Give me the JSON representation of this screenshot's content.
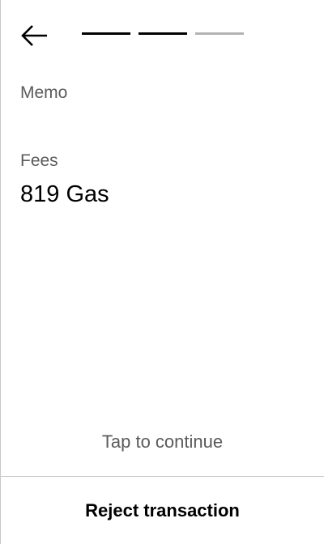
{
  "header": {
    "back_icon": "arrow-left-icon",
    "progress": {
      "total_steps": 3,
      "completed_steps": 2,
      "active_color": "#000000",
      "pending_color": "#b3b3b3"
    }
  },
  "details": {
    "memo_label": "Memo",
    "fees_label": "Fees",
    "fees_value": "819 Gas"
  },
  "footer": {
    "tap_to_continue": "Tap to continue",
    "reject_label": "Reject transaction"
  }
}
